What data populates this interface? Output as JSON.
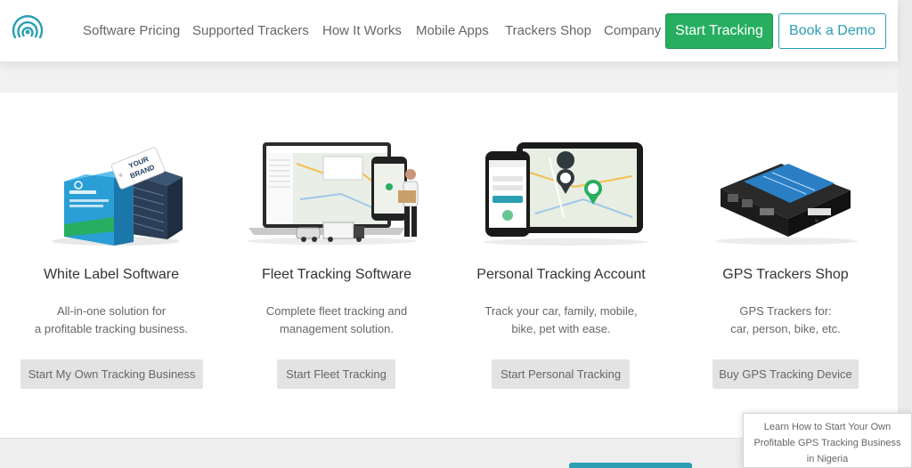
{
  "header": {
    "logo_icon": "signal-waves-icon",
    "nav": [
      {
        "label": "Software Pricing"
      },
      {
        "label": "Supported Trackers"
      },
      {
        "label": "How It Works"
      },
      {
        "label": "Mobile Apps"
      },
      {
        "label": "Trackers Shop"
      },
      {
        "label": "Company"
      }
    ],
    "start_tracking": "Start Tracking",
    "book_demo": "Book a Demo"
  },
  "colors": {
    "brand_teal": "#2a9fb4",
    "cta_green": "#27ae60",
    "button_gray": "#e3e3e3"
  },
  "cards": [
    {
      "image_icon": "software-box-icon",
      "title": "White Label Software",
      "desc": [
        "All-in-one solution for",
        "a profitable tracking business."
      ],
      "button": "Start My Own Tracking Business",
      "box_logo_text": "YOUR BRAND"
    },
    {
      "image_icon": "fleet-devices-icon",
      "title": "Fleet Tracking Software",
      "desc": [
        "Complete fleet tracking and",
        "management solution."
      ],
      "button": "Start Fleet Tracking"
    },
    {
      "image_icon": "phone-tablet-map-icon",
      "title": "Personal Tracking Account",
      "desc": [
        "Track your car, family, mobile,",
        "bike, pet with ease."
      ],
      "button": "Start Personal Tracking"
    },
    {
      "image_icon": "gps-tracker-device-icon",
      "title": "GPS Trackers Shop",
      "desc": [
        "GPS Trackers for:",
        "car, person, bike, etc."
      ],
      "button": "Buy GPS Tracking Device"
    }
  ],
  "popup": {
    "lines": [
      "Learn How to Start Your Own",
      "Profitable GPS Tracking Business",
      "in Nigeria"
    ]
  }
}
